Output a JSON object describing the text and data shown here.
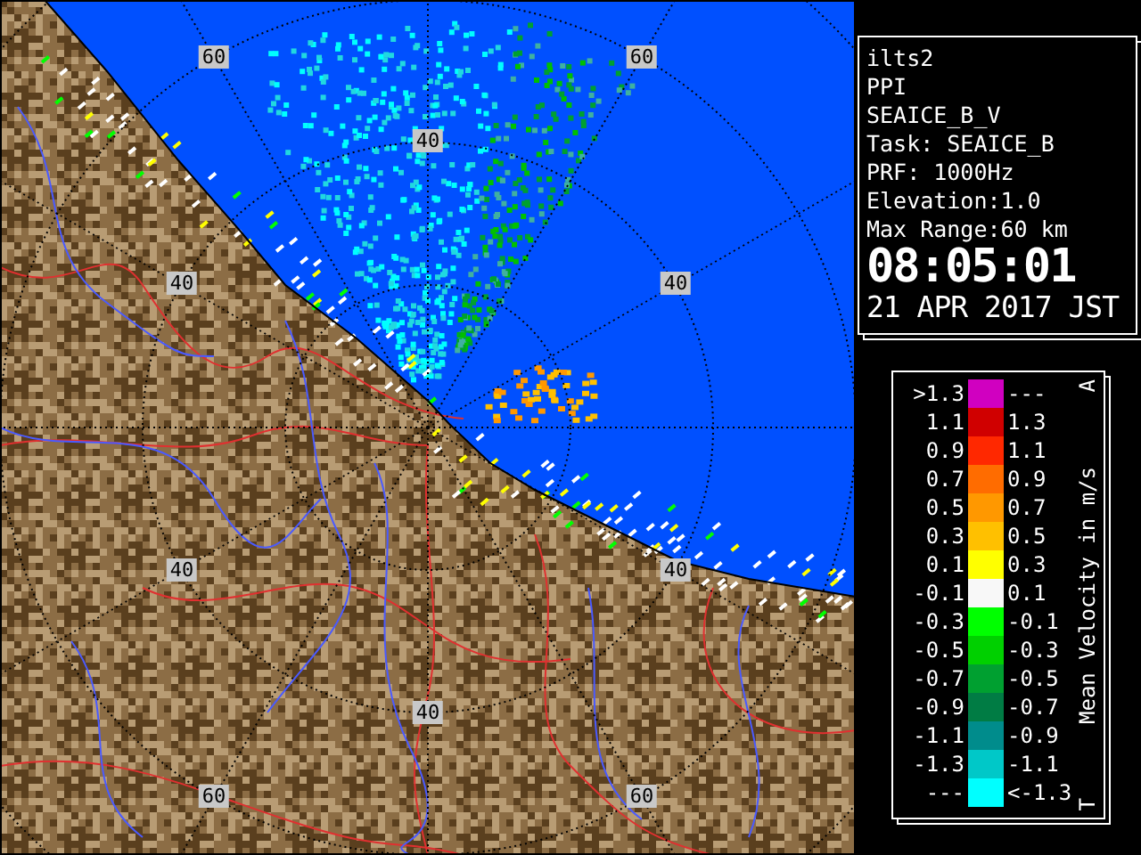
{
  "radar_map": {
    "range_labels": [
      {
        "text": "60"
      },
      {
        "text": "60"
      },
      {
        "text": "40"
      },
      {
        "text": "40"
      },
      {
        "text": "40"
      },
      {
        "text": "40"
      },
      {
        "text": "40"
      },
      {
        "text": "40"
      },
      {
        "text": "60"
      },
      {
        "text": "60"
      }
    ]
  },
  "info": {
    "lines": [
      "ilts2",
      "PPI",
      "SEAICE_B_V",
      "Task: SEAICE_B",
      "PRF: 1000Hz",
      "Elevation:1.0",
      "Max Range:60 km"
    ],
    "time": "08:05:01",
    "date": "21 APR 2017 JST"
  },
  "legend": {
    "title": "Mean Velocity in m/s",
    "top_mark": "A",
    "bottom_mark": "T",
    "rows": [
      {
        "lower": ">1.3",
        "upper": "---",
        "color": "#d000c0"
      },
      {
        "lower": "1.1",
        "upper": "1.3",
        "color": "#d00000"
      },
      {
        "lower": "0.9",
        "upper": "1.1",
        "color": "#ff2800"
      },
      {
        "lower": "0.7",
        "upper": "0.9",
        "color": "#ff6c00"
      },
      {
        "lower": "0.5",
        "upper": "0.7",
        "color": "#ff9800"
      },
      {
        "lower": "0.3",
        "upper": "0.5",
        "color": "#ffc000"
      },
      {
        "lower": "0.1",
        "upper": "0.3",
        "color": "#ffff00"
      },
      {
        "lower": "-0.1",
        "upper": "0.1",
        "color": "#f8f8f8"
      },
      {
        "lower": "-0.3",
        "upper": "-0.1",
        "color": "#00ff00"
      },
      {
        "lower": "-0.5",
        "upper": "-0.3",
        "color": "#00d000"
      },
      {
        "lower": "-0.7",
        "upper": "-0.5",
        "color": "#00a030"
      },
      {
        "lower": "-0.9",
        "upper": "-0.7",
        "color": "#007c44"
      },
      {
        "lower": "-1.1",
        "upper": "-0.9",
        "color": "#008c8c"
      },
      {
        "lower": "-1.3",
        "upper": "-1.1",
        "color": "#00c8c8"
      },
      {
        "lower": "---",
        "upper": "<-1.3",
        "color": "#00ffff"
      }
    ]
  }
}
